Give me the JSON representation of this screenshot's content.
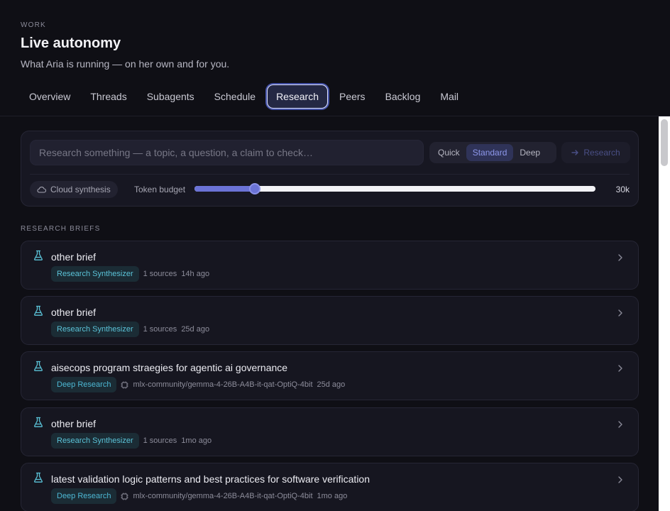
{
  "header": {
    "eyebrow": "WORK",
    "title": "Live autonomy",
    "subtitle": "What Aria is running — on her own and for you."
  },
  "tabs": [
    {
      "label": "Overview",
      "active": false
    },
    {
      "label": "Threads",
      "active": false
    },
    {
      "label": "Subagents",
      "active": false
    },
    {
      "label": "Schedule",
      "active": false
    },
    {
      "label": "Research",
      "active": true
    },
    {
      "label": "Peers",
      "active": false
    },
    {
      "label": "Backlog",
      "active": false
    },
    {
      "label": "Mail",
      "active": false
    }
  ],
  "composer": {
    "placeholder": "Research something — a topic, a question, a claim to check…",
    "depth_options": [
      {
        "label": "Quick",
        "active": false
      },
      {
        "label": "Standard",
        "active": true
      },
      {
        "label": "Deep",
        "active": false
      }
    ],
    "research_button": "Research",
    "cloud_chip": "Cloud synthesis",
    "budget_label": "Token budget",
    "budget_value": "30k",
    "budget_fraction": 0.15
  },
  "briefs_section": {
    "label": "RESEARCH BRIEFS",
    "items": [
      {
        "title": "other brief",
        "tag": "Research Synthesizer",
        "tag_kind": "synth",
        "sources": "1 sources",
        "model": "",
        "age": "14h ago"
      },
      {
        "title": "other brief",
        "tag": "Research Synthesizer",
        "tag_kind": "synth",
        "sources": "1 sources",
        "model": "",
        "age": "25d ago"
      },
      {
        "title": "aisecops program straegies for agentic ai governance",
        "tag": "Deep Research",
        "tag_kind": "deep",
        "sources": "",
        "model": "mlx-community/gemma-4-26B-A4B-it-qat-OptiQ-4bit",
        "age": "25d ago"
      },
      {
        "title": "other brief",
        "tag": "Research Synthesizer",
        "tag_kind": "synth",
        "sources": "1 sources",
        "model": "",
        "age": "1mo ago"
      },
      {
        "title": "latest validation logic patterns and best practices for software verification",
        "tag": "Deep Research",
        "tag_kind": "deep",
        "sources": "",
        "model": "mlx-community/gemma-4-26B-A4B-it-qat-OptiQ-4bit",
        "age": "1mo ago"
      }
    ]
  },
  "colors": {
    "accent": "#6b73d6",
    "tag_text": "#5bc3d8",
    "icon": "#5bc3d8"
  }
}
